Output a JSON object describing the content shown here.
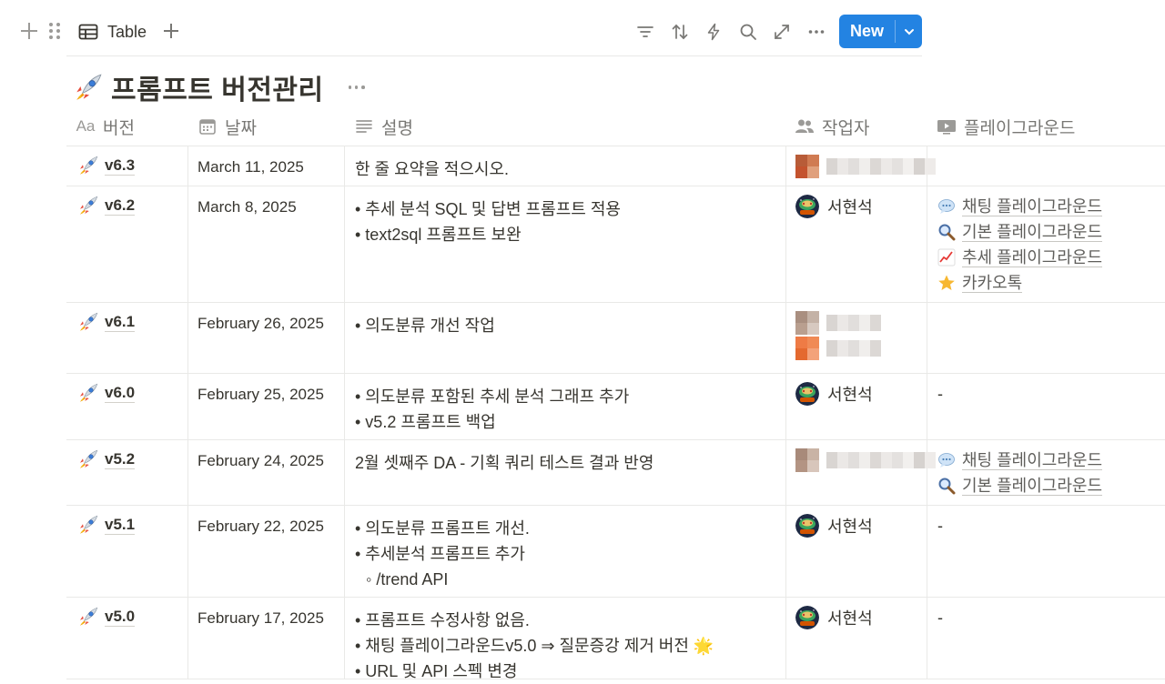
{
  "toolbar": {
    "view_label": "Table",
    "icons": [
      "filter-icon",
      "sort-icon",
      "automation-icon",
      "search-icon",
      "expand-icon",
      "more-icon"
    ],
    "new_label": "New"
  },
  "page": {
    "title": "프롬프트 버전관리"
  },
  "columns": [
    {
      "icon": "Aa",
      "label": "버전"
    },
    {
      "icon": "calendar-icon",
      "label": "날짜"
    },
    {
      "icon": "text-icon",
      "label": "설명"
    },
    {
      "icon": "people-icon",
      "label": "작업자"
    },
    {
      "icon": "relation-icon",
      "label": "플레이그라운드"
    }
  ],
  "rows": [
    {
      "version": "v6.3",
      "date": "March 11, 2025",
      "description": [
        "한 줄 요약을 적으시오."
      ],
      "authors": [
        {
          "name": "",
          "blurred": true
        }
      ],
      "playgrounds": [],
      "empty_dash": ""
    },
    {
      "version": "v6.2",
      "date": "March 8, 2025",
      "description": [
        "• 추세 분석 SQL 및 답변 프롬프트 적용",
        "• text2sql 프롬프트 보완"
      ],
      "authors": [
        {
          "name": "서현석",
          "blurred": false
        }
      ],
      "playgrounds": [
        {
          "icon": "speech-bubble-icon",
          "label": "채팅 플레이그라운드"
        },
        {
          "icon": "magnifier-icon",
          "label": "기본 플레이그라운드"
        },
        {
          "icon": "chart-up-icon",
          "label": "추세 플레이그라운드"
        },
        {
          "icon": "star-icon",
          "label": "카카오톡"
        }
      ],
      "empty_dash": ""
    },
    {
      "version": "v6.1",
      "date": "February 26, 2025",
      "description": [
        "• 의도분류 개선 작업"
      ],
      "authors": [
        {
          "name": "",
          "blurred": true
        },
        {
          "name": "",
          "blurred": true
        }
      ],
      "playgrounds": [],
      "empty_dash": ""
    },
    {
      "version": "v6.0",
      "date": "February 25, 2025",
      "description": [
        "• 의도분류 포함된 추세 분석 그래프 추가",
        "• v5.2 프롬프트 백업"
      ],
      "authors": [
        {
          "name": "서현석",
          "blurred": false
        }
      ],
      "playgrounds": [],
      "empty_dash": "-"
    },
    {
      "version": "v5.2",
      "date": "February 24, 2025",
      "description": [
        "2월 셋째주 DA - 기획 쿼리 테스트 결과 반영"
      ],
      "authors": [
        {
          "name": "",
          "blurred": true
        }
      ],
      "playgrounds": [
        {
          "icon": "speech-bubble-icon",
          "label": "채팅 플레이그라운드"
        },
        {
          "icon": "magnifier-icon",
          "label": "기본 플레이그라운드"
        }
      ],
      "empty_dash": ""
    },
    {
      "version": "v5.1",
      "date": "February 22, 2025",
      "description": [
        "• 의도분류 프롬프트 개선.",
        "• 추세분석 프롬프트 추가",
        "◦ /trend API"
      ],
      "authors": [
        {
          "name": "서현석",
          "blurred": false
        }
      ],
      "playgrounds": [],
      "empty_dash": "-"
    },
    {
      "version": "v5.0",
      "date": "February 17, 2025",
      "description": [
        "• 프롬프트 수정사항 없음.",
        "• 채팅 플레이그라운드v5.0 ⇒ 질문증강 제거 버전 🌟",
        "• URL 및 API 스펙 변경"
      ],
      "authors": [
        {
          "name": "서현석",
          "blurred": false
        }
      ],
      "playgrounds": [],
      "empty_dash": "-"
    }
  ],
  "colors": {
    "accent": "#2383e2",
    "text": "#37352f",
    "muted": "#787774",
    "border": "#e9e9e7"
  }
}
